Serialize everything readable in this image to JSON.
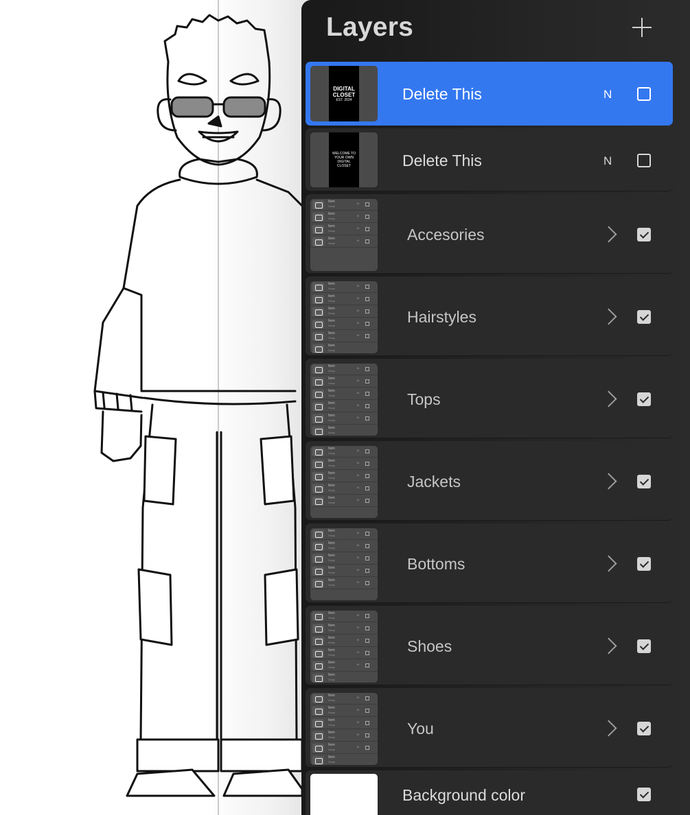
{
  "panel": {
    "title": "Layers",
    "add_icon": "plus-icon"
  },
  "layers": [
    {
      "name": "Delete This",
      "blend": "N",
      "visible": false,
      "selected": true,
      "poster_line1": "DIGITAL CLOSET",
      "poster_line2": "EST. 2024"
    },
    {
      "name": "Delete This",
      "blend": "N",
      "visible": false,
      "selected": false,
      "poster_line1": "WELCOME TO YOUR OWN DIGITAL CLOSET",
      "poster_line2": ""
    },
    {
      "name": "Accesories",
      "group": true,
      "visible": true
    },
    {
      "name": "Hairstyles",
      "group": true,
      "visible": true
    },
    {
      "name": "Tops",
      "group": true,
      "visible": true
    },
    {
      "name": "Jackets",
      "group": true,
      "visible": true
    },
    {
      "name": "Bottoms",
      "group": true,
      "visible": true
    },
    {
      "name": "Shoes",
      "group": true,
      "visible": true
    },
    {
      "name": "You",
      "group": true,
      "visible": true
    },
    {
      "name": "Background color",
      "visible": true
    }
  ],
  "mini": {
    "item_label": "Item",
    "item_sub": "Group",
    "blend": "N"
  },
  "colors": {
    "accent": "#3478f0",
    "panel_bg": "#1e1e1e",
    "row_bg": "#2a2a2a"
  }
}
